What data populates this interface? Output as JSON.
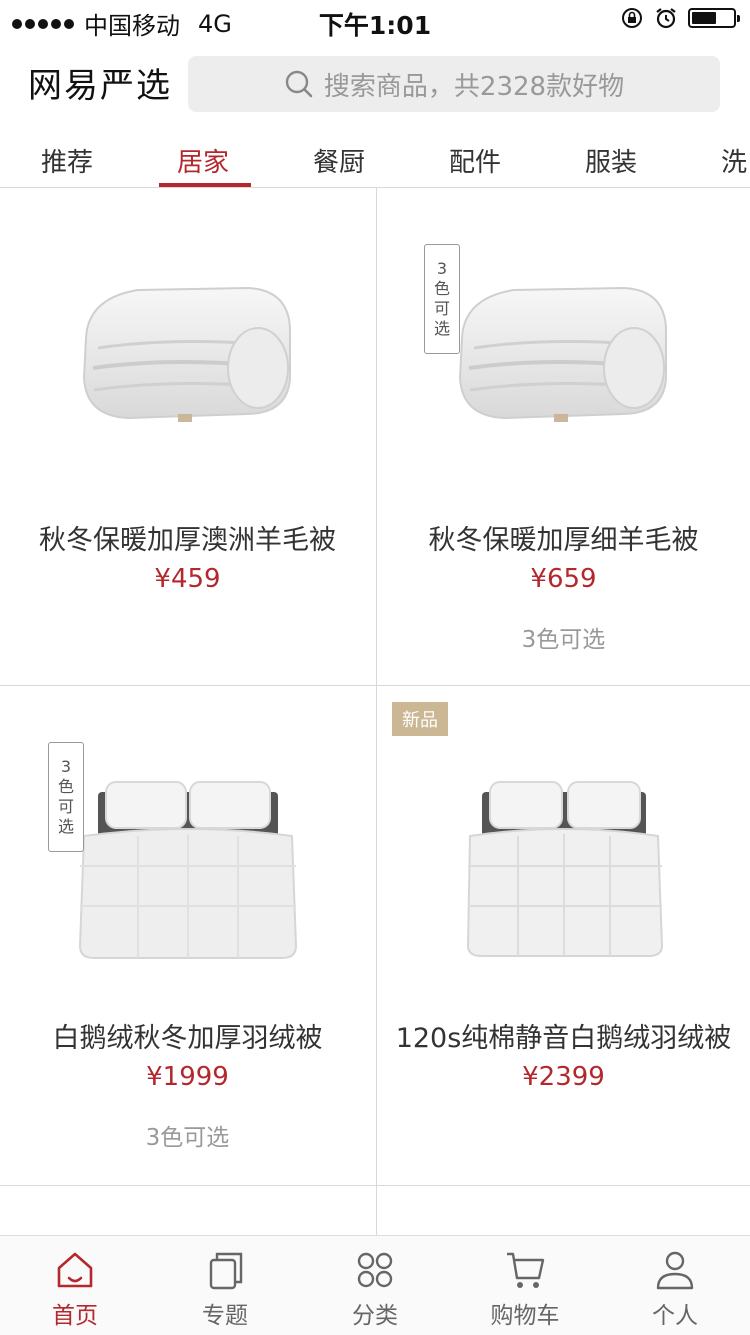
{
  "status_bar": {
    "carrier": "中国移动",
    "network": "4G",
    "time": "下午1:01"
  },
  "header": {
    "logo": "网易严选",
    "search_placeholder": "搜索商品，共2328款好物"
  },
  "tabs": [
    {
      "label": "推荐",
      "active": false
    },
    {
      "label": "居家",
      "active": true
    },
    {
      "label": "餐厨",
      "active": false
    },
    {
      "label": "配件",
      "active": false
    },
    {
      "label": "服装",
      "active": false
    },
    {
      "label": "洗",
      "active": false
    }
  ],
  "products": [
    {
      "name": "秋冬保暖加厚澳洲羊毛被",
      "price": "¥459",
      "color_note": "",
      "vertical_tag": [],
      "new_tag": "",
      "image": "folded-comforter"
    },
    {
      "name": "秋冬保暖加厚细羊毛被",
      "price": "¥659",
      "color_note": "3色可选",
      "vertical_tag": [
        "3",
        "色",
        "可",
        "选"
      ],
      "new_tag": "",
      "image": "folded-comforter"
    },
    {
      "name": "白鹅绒秋冬加厚羽绒被",
      "price": "¥1999",
      "color_note": "3色可选",
      "vertical_tag": [
        "3",
        "色",
        "可",
        "选"
      ],
      "new_tag": "",
      "image": "bed-duvet"
    },
    {
      "name": "120s纯棉静音白鹅绒羽绒被",
      "price": "¥2399",
      "color_note": "",
      "vertical_tag": [],
      "new_tag": "新品",
      "image": "bed-duvet"
    }
  ],
  "tab_bar": [
    {
      "label": "首页",
      "icon": "home-icon",
      "active": true
    },
    {
      "label": "专题",
      "icon": "topic-icon",
      "active": false
    },
    {
      "label": "分类",
      "icon": "category-icon",
      "active": false
    },
    {
      "label": "购物车",
      "icon": "cart-icon",
      "active": false
    },
    {
      "label": "个人",
      "icon": "person-icon",
      "active": false
    }
  ],
  "colors": {
    "accent": "#b4282d",
    "new_tag": "#ccb794"
  }
}
